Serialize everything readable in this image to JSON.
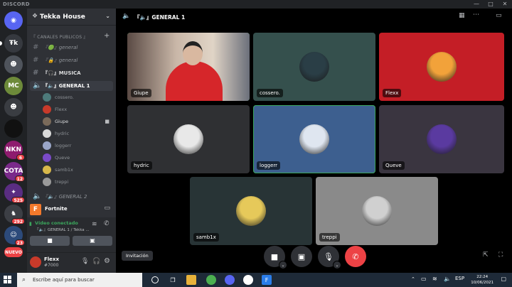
{
  "window": {
    "title": "DISCORD",
    "minimize": "—",
    "maximize": "□",
    "close": "✕"
  },
  "guilds": [
    {
      "label": "◉",
      "color": "#5865f2",
      "badge": ""
    },
    {
      "label": "Ŧk",
      "color": "#36393f",
      "badge": ""
    },
    {
      "label": "☻",
      "color": "#4f545c",
      "badge": ""
    },
    {
      "label": "MC",
      "color": "#6d8a3a",
      "badge": ""
    },
    {
      "label": "☻",
      "color": "#3a3d42",
      "badge": ""
    },
    {
      "label": "",
      "color": "#111111",
      "badge": ""
    },
    {
      "label": "NKN",
      "color": "#8e1b6e",
      "badge": "6"
    },
    {
      "label": "COTA",
      "color": "#7a2a8a",
      "badge": "12"
    },
    {
      "label": "✦",
      "color": "#5a2d82",
      "badge": "525"
    },
    {
      "label": "♞",
      "color": "#3c3f45",
      "badge": "292"
    },
    {
      "label": "☺",
      "color": "#2c4a7a",
      "badge": "23"
    },
    {
      "label": "NUEVO",
      "color": "#ed4245",
      "badge": ""
    }
  ],
  "server": {
    "name": "Tekka House",
    "lead": "❖"
  },
  "category": "『 CANALES PUBLICOS 』",
  "channels": [
    {
      "label": "『🟢』general",
      "style": "italic"
    },
    {
      "label": "『🔒』general",
      "style": "italic"
    },
    {
      "label": "『🎧』MUSICA",
      "style": "bold"
    },
    {
      "label": "『🔈』GENERAL 1",
      "style": "active"
    }
  ],
  "members": [
    {
      "name": "cossero.",
      "color": "#4d7a7a"
    },
    {
      "name": "Flexx",
      "color": "#c83a2a"
    },
    {
      "name": "Giupe",
      "color": "#7a6a5a",
      "self": true
    },
    {
      "name": "hydric",
      "color": "#d9d9d9"
    },
    {
      "name": "loggerr",
      "color": "#9aa6c8"
    },
    {
      "name": "Queve",
      "color": "#7a4ac8"
    },
    {
      "name": "samb1x",
      "color": "#d8b84a"
    },
    {
      "name": "treppi",
      "color": "#9a9a9a"
    }
  ],
  "channel_after": "『🔈』GENERAL 2",
  "activity": {
    "name": "Fortnite",
    "icon": "F"
  },
  "voice": {
    "status": "Vídeo conectado",
    "location": "『🔈』GENERAL 1 / Tekka ..."
  },
  "user": {
    "name": "Flexx",
    "tag": "#7000"
  },
  "topbar": {
    "channel": "『🔈』GENERAL 1"
  },
  "tiles": [
    {
      "name": "Giupe",
      "kind": "video",
      "bg": "#3a3f49"
    },
    {
      "name": "cossero.",
      "kind": "avatar",
      "bg": "#35504d",
      "av": "#2a3e46"
    },
    {
      "name": "Flexx",
      "kind": "avatar",
      "bg": "#c41e26",
      "av": "#f2a23a"
    },
    {
      "name": "hydric",
      "kind": "avatar",
      "bg": "#2f3033",
      "av": "#e8e8e8"
    },
    {
      "name": "loggerr",
      "kind": "avatar",
      "bg": "#3d5f8f",
      "av": "#dfe6f0"
    },
    {
      "name": "Queve",
      "kind": "avatar",
      "bg": "#3a3540",
      "av": "#5a3aa0"
    },
    {
      "name": "samb1x",
      "kind": "avatar",
      "bg": "#283436",
      "av": "#e6c95a"
    },
    {
      "name": "treppi",
      "kind": "avatar",
      "bg": "#8a8a8a",
      "av": "#d0d0d0"
    }
  ],
  "controls": {
    "invite": "Invitación"
  },
  "taskbar": {
    "search": "Escribe aquí para buscar",
    "time": "22:24",
    "date": "10/06/2021"
  }
}
